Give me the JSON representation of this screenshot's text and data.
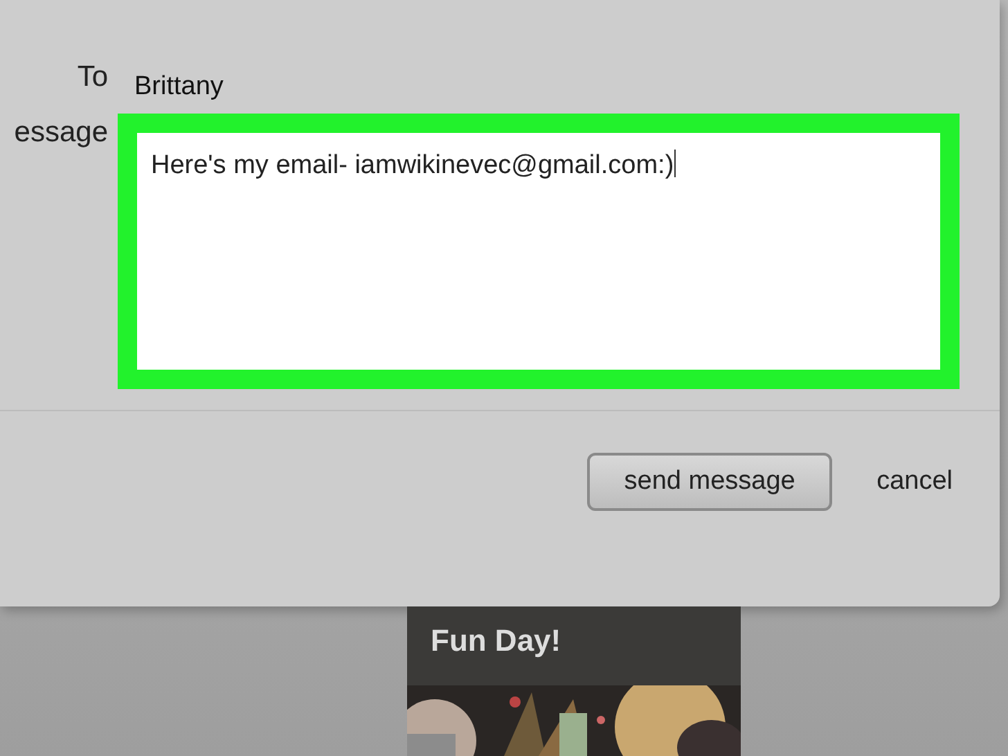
{
  "dialog": {
    "fields": [
      {
        "label": "To",
        "value": "Brittany",
        "kind": "text"
      },
      {
        "label": "essage",
        "value": "Here's my email- iamwikinevec@gmail.com:)",
        "kind": "textarea",
        "highlighted": true
      }
    ],
    "buttons": [
      {
        "label": "send message",
        "kind": "primary"
      },
      {
        "label": "cancel",
        "kind": "link"
      }
    ]
  },
  "card": {
    "title": "Fun Day!"
  }
}
